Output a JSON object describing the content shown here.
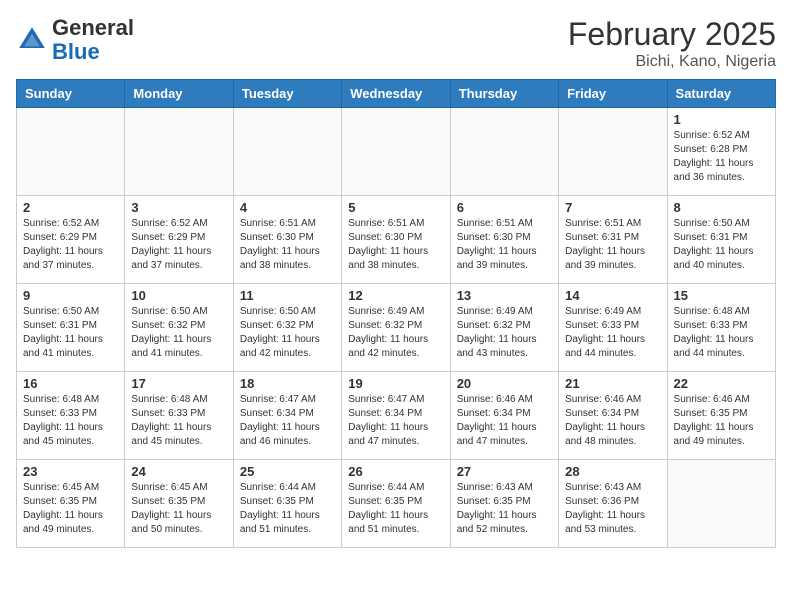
{
  "header": {
    "logo_line1": "General",
    "logo_line2": "Blue",
    "month": "February 2025",
    "location": "Bichi, Kano, Nigeria"
  },
  "weekdays": [
    "Sunday",
    "Monday",
    "Tuesday",
    "Wednesday",
    "Thursday",
    "Friday",
    "Saturday"
  ],
  "weeks": [
    [
      {
        "day": "",
        "content": ""
      },
      {
        "day": "",
        "content": ""
      },
      {
        "day": "",
        "content": ""
      },
      {
        "day": "",
        "content": ""
      },
      {
        "day": "",
        "content": ""
      },
      {
        "day": "",
        "content": ""
      },
      {
        "day": "1",
        "content": "Sunrise: 6:52 AM\nSunset: 6:28 PM\nDaylight: 11 hours and 36 minutes."
      }
    ],
    [
      {
        "day": "2",
        "content": "Sunrise: 6:52 AM\nSunset: 6:29 PM\nDaylight: 11 hours and 37 minutes."
      },
      {
        "day": "3",
        "content": "Sunrise: 6:52 AM\nSunset: 6:29 PM\nDaylight: 11 hours and 37 minutes."
      },
      {
        "day": "4",
        "content": "Sunrise: 6:51 AM\nSunset: 6:30 PM\nDaylight: 11 hours and 38 minutes."
      },
      {
        "day": "5",
        "content": "Sunrise: 6:51 AM\nSunset: 6:30 PM\nDaylight: 11 hours and 38 minutes."
      },
      {
        "day": "6",
        "content": "Sunrise: 6:51 AM\nSunset: 6:30 PM\nDaylight: 11 hours and 39 minutes."
      },
      {
        "day": "7",
        "content": "Sunrise: 6:51 AM\nSunset: 6:31 PM\nDaylight: 11 hours and 39 minutes."
      },
      {
        "day": "8",
        "content": "Sunrise: 6:50 AM\nSunset: 6:31 PM\nDaylight: 11 hours and 40 minutes."
      }
    ],
    [
      {
        "day": "9",
        "content": "Sunrise: 6:50 AM\nSunset: 6:31 PM\nDaylight: 11 hours and 41 minutes."
      },
      {
        "day": "10",
        "content": "Sunrise: 6:50 AM\nSunset: 6:32 PM\nDaylight: 11 hours and 41 minutes."
      },
      {
        "day": "11",
        "content": "Sunrise: 6:50 AM\nSunset: 6:32 PM\nDaylight: 11 hours and 42 minutes."
      },
      {
        "day": "12",
        "content": "Sunrise: 6:49 AM\nSunset: 6:32 PM\nDaylight: 11 hours and 42 minutes."
      },
      {
        "day": "13",
        "content": "Sunrise: 6:49 AM\nSunset: 6:32 PM\nDaylight: 11 hours and 43 minutes."
      },
      {
        "day": "14",
        "content": "Sunrise: 6:49 AM\nSunset: 6:33 PM\nDaylight: 11 hours and 44 minutes."
      },
      {
        "day": "15",
        "content": "Sunrise: 6:48 AM\nSunset: 6:33 PM\nDaylight: 11 hours and 44 minutes."
      }
    ],
    [
      {
        "day": "16",
        "content": "Sunrise: 6:48 AM\nSunset: 6:33 PM\nDaylight: 11 hours and 45 minutes."
      },
      {
        "day": "17",
        "content": "Sunrise: 6:48 AM\nSunset: 6:33 PM\nDaylight: 11 hours and 45 minutes."
      },
      {
        "day": "18",
        "content": "Sunrise: 6:47 AM\nSunset: 6:34 PM\nDaylight: 11 hours and 46 minutes."
      },
      {
        "day": "19",
        "content": "Sunrise: 6:47 AM\nSunset: 6:34 PM\nDaylight: 11 hours and 47 minutes."
      },
      {
        "day": "20",
        "content": "Sunrise: 6:46 AM\nSunset: 6:34 PM\nDaylight: 11 hours and 47 minutes."
      },
      {
        "day": "21",
        "content": "Sunrise: 6:46 AM\nSunset: 6:34 PM\nDaylight: 11 hours and 48 minutes."
      },
      {
        "day": "22",
        "content": "Sunrise: 6:46 AM\nSunset: 6:35 PM\nDaylight: 11 hours and 49 minutes."
      }
    ],
    [
      {
        "day": "23",
        "content": "Sunrise: 6:45 AM\nSunset: 6:35 PM\nDaylight: 11 hours and 49 minutes."
      },
      {
        "day": "24",
        "content": "Sunrise: 6:45 AM\nSunset: 6:35 PM\nDaylight: 11 hours and 50 minutes."
      },
      {
        "day": "25",
        "content": "Sunrise: 6:44 AM\nSunset: 6:35 PM\nDaylight: 11 hours and 51 minutes."
      },
      {
        "day": "26",
        "content": "Sunrise: 6:44 AM\nSunset: 6:35 PM\nDaylight: 11 hours and 51 minutes."
      },
      {
        "day": "27",
        "content": "Sunrise: 6:43 AM\nSunset: 6:35 PM\nDaylight: 11 hours and 52 minutes."
      },
      {
        "day": "28",
        "content": "Sunrise: 6:43 AM\nSunset: 6:36 PM\nDaylight: 11 hours and 53 minutes."
      },
      {
        "day": "",
        "content": ""
      }
    ]
  ]
}
